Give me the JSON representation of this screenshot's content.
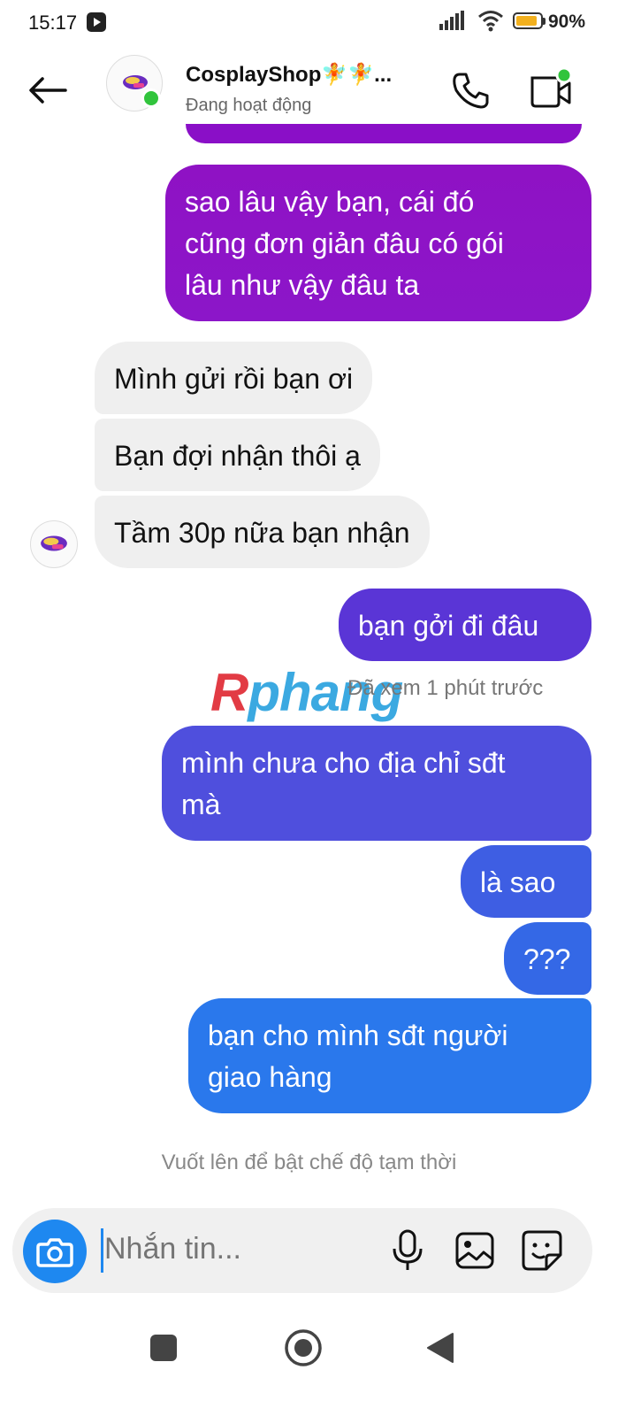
{
  "status_bar": {
    "time": "15:17",
    "battery_percent": "90%",
    "battery_level": 0.9,
    "battery_color": "#f2b01e"
  },
  "header": {
    "contact_name": "CosplayShop🧚🧚...",
    "contact_status": "Đang hoạt động",
    "online_color": "#31c43c"
  },
  "messages": [
    {
      "direction": "outgoing",
      "text": "sao lâu vậy bạn, cái đó\ncũng đơn giản đâu có gói\nlâu như vậy đâu ta",
      "color": "#8f12c4"
    },
    {
      "direction": "incoming",
      "text": "Mình gửi rồi bạn ơi"
    },
    {
      "direction": "incoming",
      "text": "Bạn đợi nhận thôi ạ"
    },
    {
      "direction": "incoming",
      "text": "Tầm 30p nữa bạn nhận"
    },
    {
      "direction": "outgoing",
      "text": "bạn gởi đi đâu",
      "color": "#5a35d6"
    },
    {
      "direction": "outgoing",
      "text": "mình chưa cho địa chỉ sđt\nmà",
      "color": "#4f4fdd"
    },
    {
      "direction": "outgoing",
      "text": "là sao",
      "color": "#3e5ee3"
    },
    {
      "direction": "outgoing",
      "text": "???",
      "color": "#3468e6"
    },
    {
      "direction": "outgoing",
      "text": "bạn cho mình sđt người\ngiao hàng",
      "color": "#2a78ec"
    }
  ],
  "seen_indicator": "Đã xem 1 phút trước",
  "watermark": {
    "first": "R",
    "rest": "phang"
  },
  "hint": "Vuốt lên để bật chế độ tạm thời",
  "composer": {
    "placeholder": "Nhắn tin..."
  },
  "icons": {
    "back": "arrow-left-icon",
    "call": "phone-icon",
    "video": "video-camera-icon",
    "camera": "camera-icon",
    "mic": "microphone-icon",
    "gallery": "image-icon",
    "sticker": "sticker-icon"
  }
}
